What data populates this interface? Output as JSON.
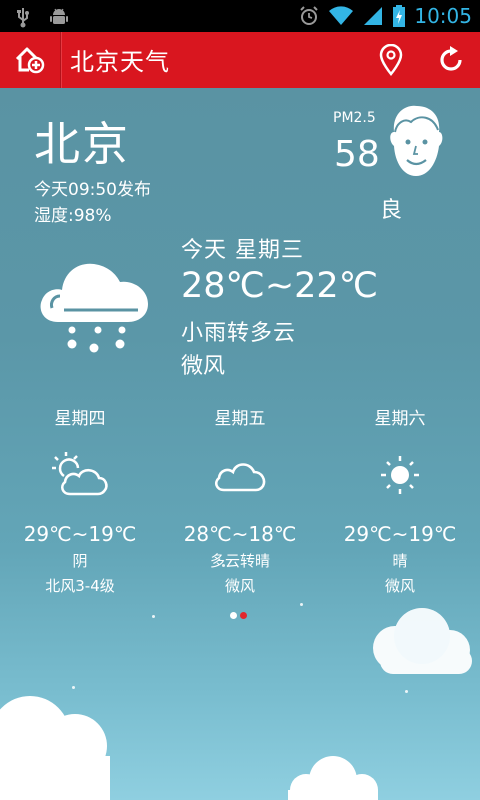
{
  "status_bar": {
    "time": "10:05",
    "icons": [
      "usb-icon",
      "android-debug-icon",
      "alarm-icon",
      "wifi-icon",
      "signal-icon",
      "battery-charging-icon"
    ]
  },
  "title_bar": {
    "title": "北京天气",
    "icons": [
      "add-city-icon",
      "location-pin-icon",
      "refresh-icon"
    ],
    "color": "#d9161f"
  },
  "current": {
    "city": "北京",
    "publish_time": "今天09:50发布",
    "humidity": "湿度:98%",
    "pm_label": "PM2.5",
    "pm_value": "58",
    "pm_quality": "良",
    "today_label": "今天 星期三",
    "temperature": "28℃~22℃",
    "condition": "小雨转多云",
    "wind": "微风",
    "icon": "light-rain-cloud-icon"
  },
  "forecast": [
    {
      "day": "星期四",
      "icon": "partly-cloudy-icon",
      "temperature": "29℃~19℃",
      "condition": "阴",
      "wind": "北风3-4级"
    },
    {
      "day": "星期五",
      "icon": "cloud-icon",
      "temperature": "28℃~18℃",
      "condition": "多云转晴",
      "wind": "微风"
    },
    {
      "day": "星期六",
      "icon": "sun-icon",
      "temperature": "29℃~19℃",
      "condition": "晴",
      "wind": "微风"
    }
  ],
  "pager": {
    "pages": 2,
    "active": 2
  }
}
